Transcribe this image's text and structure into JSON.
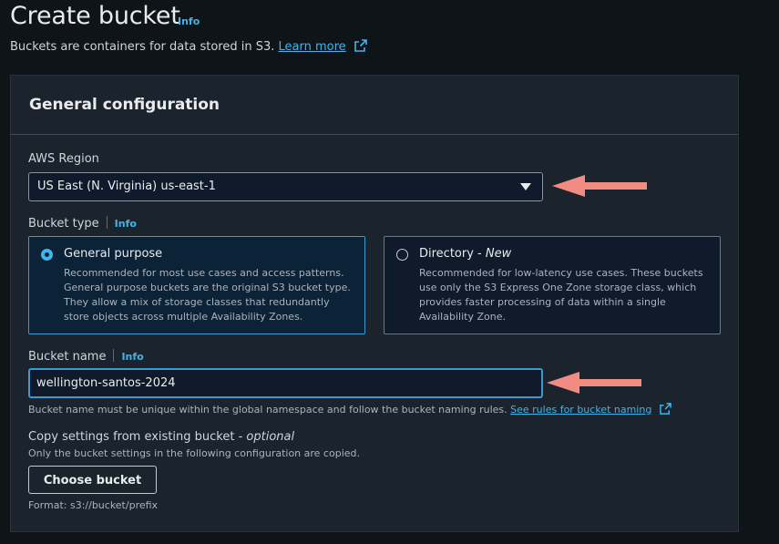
{
  "page": {
    "title": "Create bucket",
    "info": "Info",
    "description": "Buckets are containers for data stored in S3.",
    "learn_more": "Learn more"
  },
  "general_config": {
    "title": "General configuration",
    "region": {
      "label": "AWS Region",
      "value": "US East (N. Virginia) us-east-1"
    },
    "bucket_type": {
      "label": "Bucket type",
      "info": "Info",
      "options": [
        {
          "title": "General purpose",
          "description": "Recommended for most use cases and access patterns. General purpose buckets are the original S3 bucket type. They allow a mix of storage classes that redundantly store objects across multiple Availability Zones.",
          "selected": true
        },
        {
          "title": "Directory - ",
          "badge": "New",
          "description": "Recommended for low-latency use cases. These buckets use only the S3 Express One Zone storage class, which provides faster processing of data within a single Availability Zone.",
          "selected": false
        }
      ]
    },
    "bucket_name": {
      "label": "Bucket name",
      "info": "Info",
      "value": "wellington-santos-2024",
      "hint": "Bucket name must be unique within the global namespace and follow the bucket naming rules.",
      "rules_link": "See rules for bucket naming"
    },
    "copy_settings": {
      "label": "Copy settings from existing bucket - ",
      "optional": "optional",
      "description": "Only the bucket settings in the following configuration are copied.",
      "button": "Choose bucket",
      "format": "Format: s3://bucket/prefix"
    }
  },
  "colors": {
    "background": "#0f1419",
    "panel": "#1b232d",
    "accent": "#42b4ea",
    "annotation_arrow": "#f28b82"
  }
}
